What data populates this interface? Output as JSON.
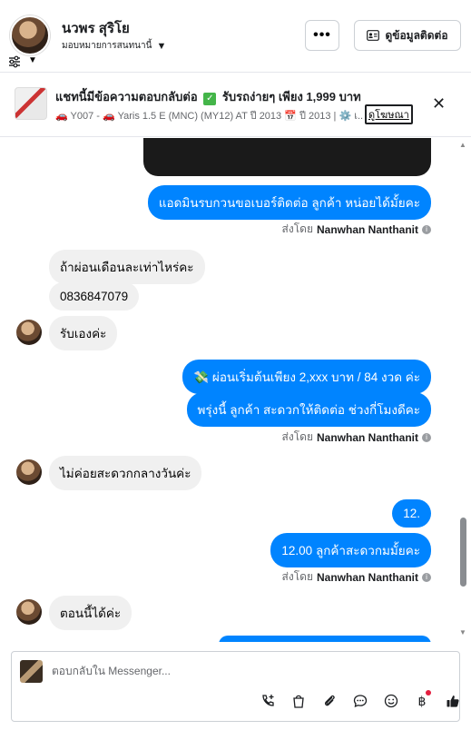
{
  "header": {
    "name": "นวพร สุริโย",
    "assign_label": "มอบหมายการสนทนานี้",
    "more_label": "•••",
    "contact_button": "ดูข้อมูลติดต่อ"
  },
  "ad": {
    "title_prefix": "แชทนี้มีข้อความตอบกลับต่อ",
    "title_suffix": "รับรถง่ายๆ เพียง 1,999 บาท",
    "subtitle": "🚗 Y007 - 🚗 Yaris 1.5 E (MNC) (MY12) AT ปี 2013 📅 ปี 2013 | ⚙️ เ...",
    "link": "ดูโฆษณา"
  },
  "messages": {
    "m1": "แอดมินรบกวนขอเบอร์ติดต่อ ลูกค้า หน่อยได้มั้ยคะ",
    "m2": "ถ้าผ่อนเดือนละเท่าไหร่คะ",
    "m3": "0836847079",
    "m4": "รับเองค่ะ",
    "m5": "💸 ผ่อนเริ่มต้นเพียง 2,xxx บาท / 84 งวด ค่ะ",
    "m6": "พรุ่งนี้ ลูกค้า สะดวกให้ติดต่อ ช่วงกี่โมงดีคะ",
    "m7": "ไม่ค่อยสะดวกกลางวันค่ะ",
    "m8": "12.",
    "m9": "12.00 ลูกค้าสะดวกมมั้ยคะ",
    "m10": "ตอนนี้ได้ค่ะ"
  },
  "sent_by": {
    "prefix": "ส่งโดย",
    "agent": "Nanwhan Nanthanit"
  },
  "composer": {
    "placeholder": "ตอบกลับใน Messenger..."
  },
  "icons": [
    "filter-icon",
    "chevron-down-icon",
    "more-icon",
    "contact-card-icon",
    "close-icon",
    "info-icon",
    "call-add-icon",
    "shopping-bag-icon",
    "attachment-icon",
    "saved-reply-icon",
    "emoji-icon",
    "payment-icon",
    "thumbs-up-icon"
  ],
  "colors": {
    "accent": "#0084ff",
    "incoming_bubble": "#f0f0f0",
    "notification_dot": "#e41e3f"
  }
}
